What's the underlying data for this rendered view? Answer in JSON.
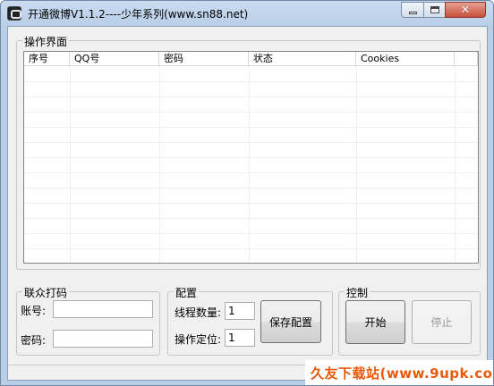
{
  "window": {
    "title": "开通微博V1.1.2----少年系列(www.sn88.net)",
    "caption_buttons": {
      "minimize": "minimize-icon",
      "maximize": "maximize-icon",
      "close": "close-icon"
    }
  },
  "operation_group": {
    "label": "操作界面",
    "columns": [
      "序号",
      "QQ号",
      "密码",
      "状态",
      "Cookies"
    ]
  },
  "captcha_group": {
    "label": "联众打码",
    "account_label": "账号:",
    "account_value": "",
    "password_label": "密码:",
    "password_value": ""
  },
  "config_group": {
    "label": "配置",
    "threads_label": "线程数量:",
    "threads_value": "1",
    "position_label": "操作定位:",
    "position_value": "1",
    "save_button": "保存配置"
  },
  "control_group": {
    "label": "控制",
    "start_button": "开始",
    "stop_button": "停止"
  },
  "watermark": "久友下载站(www.9upk.com)",
  "colors": {
    "titlebar": "#b9cfe8",
    "client_bg": "#f0f0f0",
    "watermark": "#e8590c",
    "close_button": "#c7503c"
  }
}
